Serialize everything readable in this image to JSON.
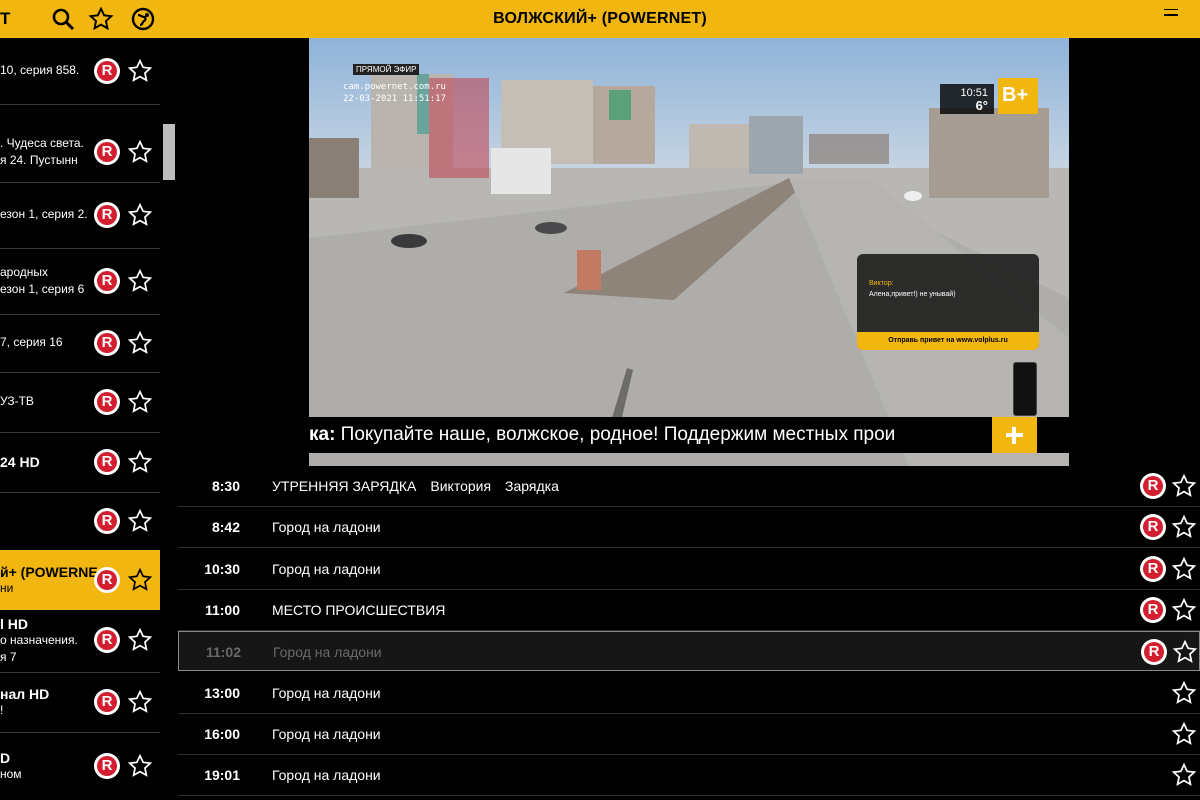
{
  "app": {
    "title": "ВОЛЖСКИЙ+ (POWERNET)",
    "logo_fragment": "T",
    "accent": "#f2b611",
    "rec_color": "#d21e2e"
  },
  "toolbar": {
    "icons": [
      "search-icon",
      "star-icon",
      "globe-icon"
    ],
    "window": [
      "minimize-icon"
    ]
  },
  "channels": [
    {
      "lines": [
        "10, серия 858."
      ],
      "active": false
    },
    {
      "lines": [
        ". Чудеса света.",
        "я 24. Пустынн"
      ],
      "active": false
    },
    {
      "lines": [
        "езон 1, серия 2."
      ],
      "active": false
    },
    {
      "lines": [
        "ародных",
        "езон 1, серия 6"
      ],
      "active": false
    },
    {
      "lines": [
        "7, серия 16"
      ],
      "active": false
    },
    {
      "lines": [
        "УЗ-ТВ"
      ],
      "active": false
    },
    {
      "lines": [
        "24 HD"
      ],
      "active": false,
      "bold": true
    },
    {
      "lines": [
        ""
      ],
      "active": false
    },
    {
      "lines": [
        "й+ (POWERNE",
        "ни"
      ],
      "active": true,
      "bold": true
    },
    {
      "lines": [
        "l HD",
        "о назначения.",
        "я 7"
      ],
      "active": false,
      "bold": true
    },
    {
      "lines": [
        "нал HD",
        "!"
      ],
      "active": false,
      "bold": true
    },
    {
      "lines": [
        "D",
        "ном"
      ],
      "active": false,
      "bold": true
    }
  ],
  "video": {
    "ticker_bold": "ка:",
    "ticker_text": " Покупайте наше, волжское, родное! Поддержим местных прои",
    "greeting_name": "Виктор:",
    "greeting_msg": "Алена,привет!) не унывай)",
    "greeting_cta": "Отправь привет на www.volplus.ru",
    "weather_time": "10:51",
    "weather_temp": "6°",
    "brand_badge": "В+",
    "osd_live": "ПРЯМОЙ ЭФИР",
    "osd_url": "cam.powernet.com.ru",
    "osd_date": "22-03-2021 11:51:17"
  },
  "schedule": [
    {
      "time": "8:30",
      "title": "УТРЕННЯЯ ЗАРЯДКА",
      "extra": [
        "Виктория",
        "Зарядка"
      ],
      "rec": true,
      "selected": false
    },
    {
      "time": "8:42",
      "title": "Город на ладони",
      "extra": [],
      "rec": true,
      "selected": false
    },
    {
      "time": "10:30",
      "title": "Город на ладони",
      "extra": [],
      "rec": true,
      "selected": false
    },
    {
      "time": "11:00",
      "title": "МЕСТО ПРОИСШЕСТВИЯ",
      "extra": [],
      "rec": true,
      "selected": false
    },
    {
      "time": "11:02",
      "title": "Город на ладони",
      "extra": [],
      "rec": true,
      "selected": true
    },
    {
      "time": "13:00",
      "title": "Город на ладони",
      "extra": [],
      "rec": false,
      "selected": false
    },
    {
      "time": "16:00",
      "title": "Город на ладони",
      "extra": [],
      "rec": false,
      "selected": false
    },
    {
      "time": "19:01",
      "title": "Город на ладони",
      "extra": [],
      "rec": false,
      "selected": false
    }
  ],
  "rec_letter": "R"
}
